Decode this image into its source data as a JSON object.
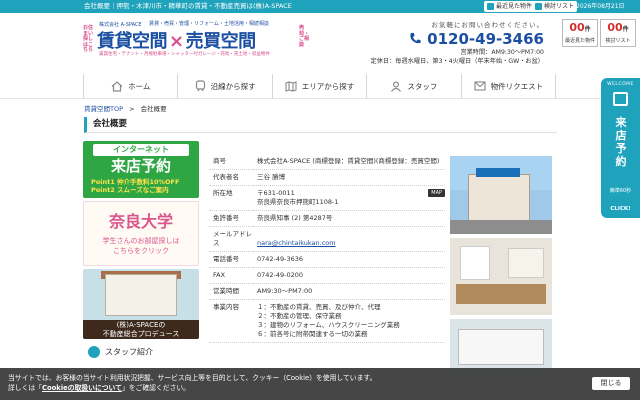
{
  "header": {
    "tagline": "会社概要｜押熊・木津川市・精華町の賃貸・不動産売買は(株)A-SPACE",
    "recent_label": "最近見た物件",
    "review_label": "検討リスト",
    "date": "2026年08月21日"
  },
  "logo": {
    "side_left": "お住まい探しはこちら",
    "side_right": "売却・ご相談",
    "corp": "株式会社 A-SPACE",
    "sub1": "賃貸・売買・管理・リフォーム・土地活用・相続相談",
    "brand_a": "賃貸空間",
    "cross": "×",
    "brand_b": "売買空間",
    "sub2": "賃貸住宅・テナント・月極駐車場・シャッター付ガレージ・売地・売土地・収益物件"
  },
  "contact": {
    "hint": "お気軽にお問い合わせください。",
    "phone": "0120-49-3466",
    "hours": "営業時間：AM9:30〜PM7:00",
    "closed": "定休日：毎週水曜日、第3・4火曜日（年末年始・GW・お盆）"
  },
  "counters": [
    {
      "num": "00",
      "unit": "件",
      "label": "最近見た物件"
    },
    {
      "num": "00",
      "unit": "件",
      "label": "検討リスト"
    }
  ],
  "nav": [
    {
      "label": "ホーム",
      "icon": "home-icon"
    },
    {
      "label": "沿線から探す",
      "icon": "train-icon"
    },
    {
      "label": "エリアから探す",
      "icon": "map-icon"
    },
    {
      "label": "スタッフ",
      "icon": "staff-icon"
    },
    {
      "label": "物件リクエスト",
      "icon": "mail-icon"
    }
  ],
  "breadcrumb": {
    "home": "賃貸空間TOP",
    "sep": ">",
    "current": "会社概要"
  },
  "page_title": "会社概要",
  "banners": {
    "b1_top": "インターネット",
    "b1_main": "来店予約",
    "b1_p1": "Point1 仲介手数料10%OFF",
    "b1_p2": "Point2 スムーズなご案内",
    "b2_main": "奈良大学",
    "b2_sub1": "学生さんのお部屋探しは",
    "b2_sub2": "こちらをクリック",
    "b3_l1": "(株)A-SPACEの",
    "b3_l2": "不動産総合プロデュース",
    "staff": "スタッフ紹介"
  },
  "company": {
    "name_label": "商号",
    "name_value": "株式会社A-SPACE (商標登録：賃貸空間)(商標登録：売買空間)",
    "rep_label": "代表者名",
    "rep_value": "三谷 勝博",
    "addr_label": "所在地",
    "addr_zip": "〒631-0011",
    "addr_value": "奈良県奈良市押熊町1108-1",
    "map_label": "MAP",
    "lic_label": "免許番号",
    "lic_value": "奈良県知事 (2) 第4287号",
    "mail_label": "メールアドレス",
    "mail_value": "nara@chintaikukan.com",
    "tel_label": "電話番号",
    "tel_value": "0742-49-3636",
    "fax_label": "FAX",
    "fax_value": "0742-49-0200",
    "hours_label": "営業時間",
    "hours_value": "AM9:30〜PM7:00",
    "biz_label": "事業内容",
    "biz_1": "１：不動産の賃貸、売買、及び仲介、代理",
    "biz_2": "２：不動産の管理、保守業務",
    "biz_3": "３：建物のリフォーム、ハウスクリーニング業務",
    "biz_4": "６：前各号に附帯関連する一切の業務"
  },
  "side_cta": {
    "welcome": "WELCOME",
    "main": "来店予約",
    "sub": "簡単60秒",
    "click": "CLICK!"
  },
  "cookie": {
    "msg_a": "当サイトでは、お客様の当サイト利用状況把握、サービス向上等を目的として、クッキー（Cookie）を使用しています。",
    "msg_b": "詳しくは「",
    "link": "Cookieの取扱いについて",
    "msg_c": "」をご確認ください。",
    "close": "閉じる"
  }
}
